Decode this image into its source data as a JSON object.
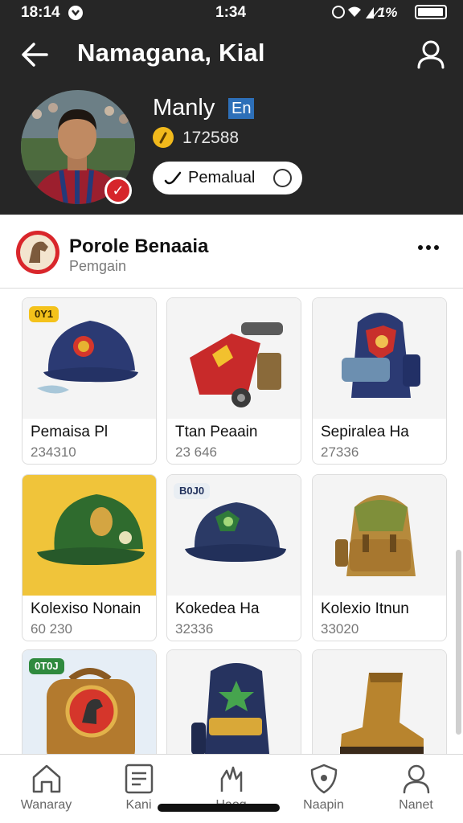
{
  "status_bar": {
    "time": "18:14",
    "clock": "1:34",
    "battery_text": "⁄1%"
  },
  "header": {
    "title": "Namagana, Kial",
    "back_icon": "arrow-left-icon",
    "profile_icon": "person-icon"
  },
  "user": {
    "name": "Manly",
    "tag": "En",
    "coins": "172588",
    "action_label": "Pemalual"
  },
  "collection": {
    "title": "Porole Benaaia",
    "subtitle": "Pemgain"
  },
  "products": [
    {
      "name": "Pemaisa Pl",
      "price": "234310",
      "badge": "0Y1",
      "image": "navy-cap"
    },
    {
      "name": "Ttan Peaain",
      "price": "23 646",
      "image": "red-cart"
    },
    {
      "name": "Sepiralea Ha",
      "price": "27336",
      "image": "navy-backpack"
    },
    {
      "name": "Kolexiso Nonain",
      "price": "60 230",
      "image": "green-cap"
    },
    {
      "name": "Kokedea Ha",
      "price": "32336",
      "badge": "B0J0",
      "image": "navy-cap-green-badge"
    },
    {
      "name": "Kolexio Itnun",
      "price": "33020",
      "image": "olive-backpack"
    },
    {
      "name": "",
      "price": "",
      "badge": "0T0J",
      "image": "brown-bag"
    },
    {
      "name": "",
      "price": "",
      "image": "navy-backpack-star"
    },
    {
      "name": "",
      "price": "",
      "image": "boot"
    }
  ],
  "nav": [
    {
      "label": "Wanaray",
      "icon": "home-icon"
    },
    {
      "label": "Kani",
      "icon": "list-icon"
    },
    {
      "label": "Haog",
      "icon": "hand-icon"
    },
    {
      "label": "Naapin",
      "icon": "shield-icon"
    },
    {
      "label": "Nanet",
      "icon": "person-icon"
    }
  ],
  "colors": {
    "header_bg": "#262626",
    "tag_blue": "#2d6fb8",
    "coin_gold": "#f1b91c",
    "brand_red": "#d9262b"
  }
}
